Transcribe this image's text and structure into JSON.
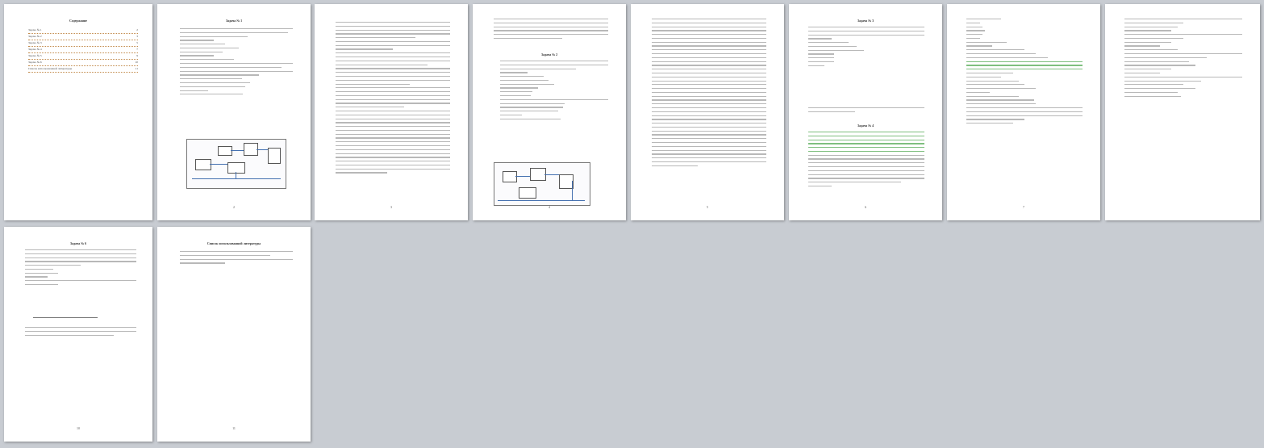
{
  "document": {
    "pages": [
      {
        "id": "p1",
        "number": "",
        "title": "Содержание",
        "toc": [
          {
            "label": "Задача № 1",
            "page": "2"
          },
          {
            "label": "Задача № 2",
            "page": "3"
          },
          {
            "label": "Задача № 3",
            "page": "5"
          },
          {
            "label": "Задача № 4",
            "page": "7"
          },
          {
            "label": "Задача № 5",
            "page": "9"
          },
          {
            "label": "Задача № 6",
            "page": "10"
          },
          {
            "label": "Список использованной литературы",
            "page": "11"
          }
        ]
      },
      {
        "id": "p2",
        "number": "2",
        "title": "Задача № 1"
      },
      {
        "id": "p3",
        "number": "3",
        "title": ""
      },
      {
        "id": "p4",
        "number": "4",
        "title": "Задача № 2"
      },
      {
        "id": "p5",
        "number": "5",
        "title": ""
      },
      {
        "id": "p6",
        "number": "6",
        "title": "Задача № 3"
      },
      {
        "id": "p7",
        "number": "7",
        "title": ""
      },
      {
        "id": "p8",
        "number": "8",
        "title": ""
      },
      {
        "id": "p9",
        "number": "10",
        "title": "Задача № 6"
      },
      {
        "id": "p10",
        "number": "11",
        "title": "Список использованной литературы"
      }
    ]
  }
}
